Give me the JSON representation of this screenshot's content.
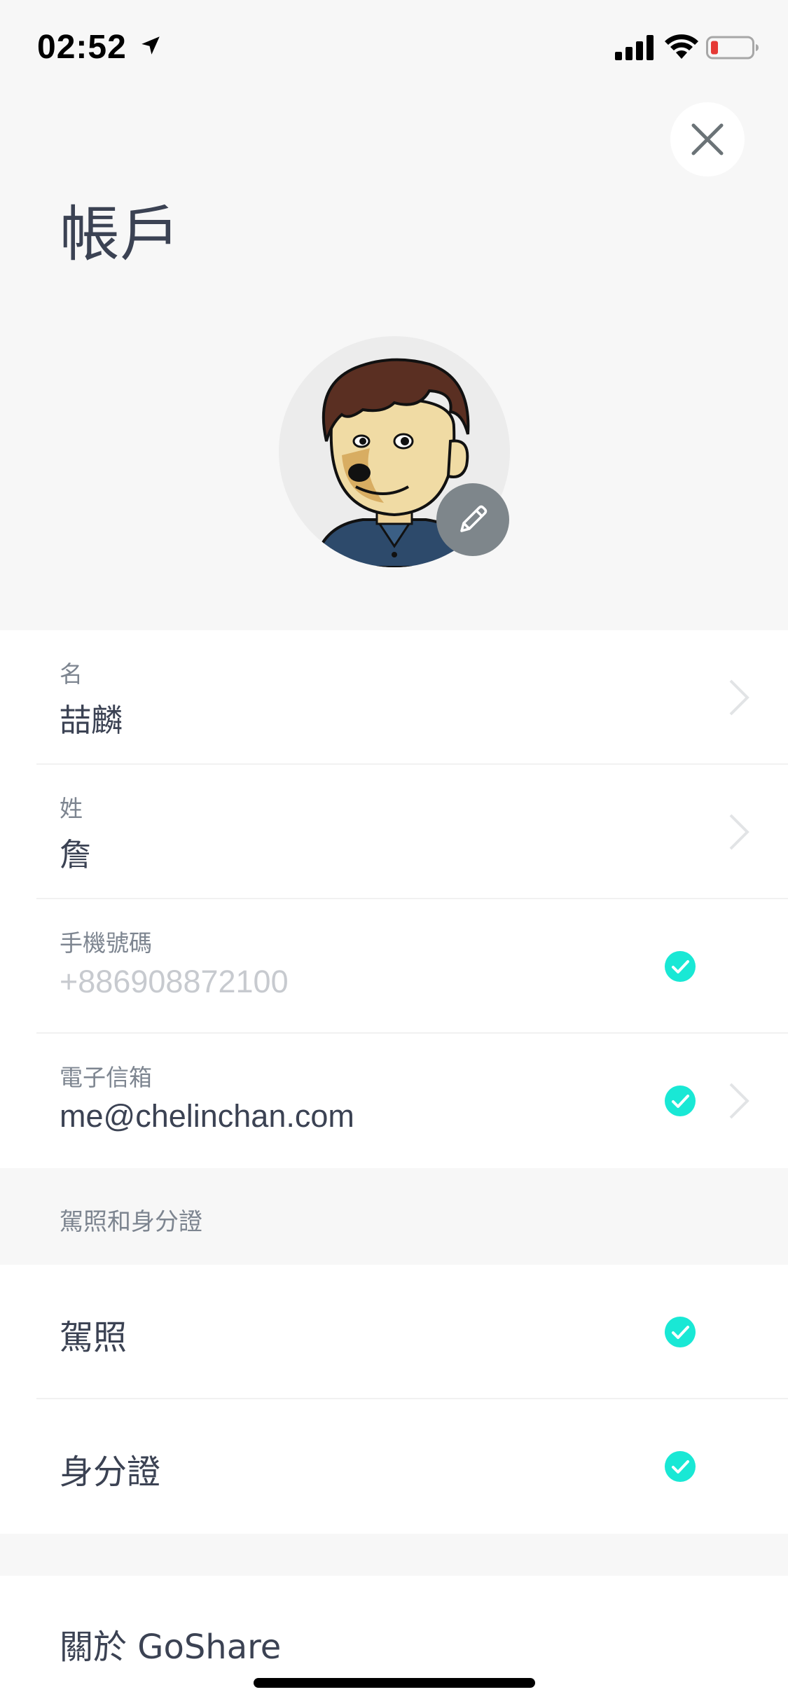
{
  "status_bar": {
    "time": "02:52",
    "icons": [
      "location-arrow-icon",
      "cellular-signal-icon",
      "wifi-icon",
      "battery-low-icon"
    ],
    "battery_color": "#e53935"
  },
  "header": {
    "title": "帳戶",
    "close_icon": "close-icon"
  },
  "profile": {
    "avatar": "avatar-illustration",
    "edit_icon": "pencil-icon"
  },
  "account_fields": [
    {
      "label": "名",
      "value": "喆麟",
      "verified": false,
      "editable": true
    },
    {
      "label": "姓",
      "value": "詹",
      "verified": false,
      "editable": true
    },
    {
      "label": "手機號碼",
      "value": "+886908872100",
      "verified": true,
      "editable": false
    },
    {
      "label": "電子信箱",
      "value": "me@chelinchan.com",
      "verified": true,
      "editable": true
    }
  ],
  "documents": {
    "header": "駕照和身分證",
    "items": [
      {
        "label": "駕照",
        "verified": true
      },
      {
        "label": "身分證",
        "verified": true
      }
    ]
  },
  "about": {
    "label": "關於 GoShare"
  },
  "colors": {
    "background": "#f7f7f7",
    "card": "#ffffff",
    "text": "#3b4253",
    "label": "#7d8590",
    "muted": "#c7cacf",
    "verified": "#19e8d5",
    "edit_button": "#7e868b"
  }
}
